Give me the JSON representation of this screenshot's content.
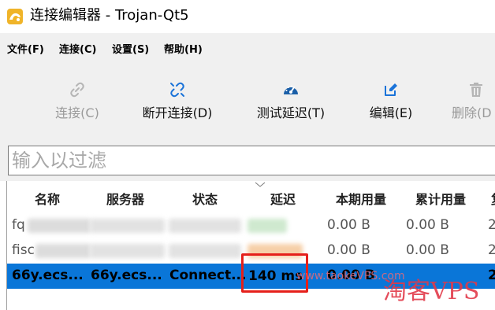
{
  "window": {
    "title": "连接编辑器 - Trojan-Qt5"
  },
  "menu": [
    {
      "label": "文件(F)"
    },
    {
      "label": "连接(C)"
    },
    {
      "label": "设置(S)"
    },
    {
      "label": "帮助(H)"
    }
  ],
  "toolbar": {
    "connect": {
      "label": "连接(C)",
      "icon": "link-icon",
      "enabled": false
    },
    "disconnect": {
      "label": "断开连接(D)",
      "icon": "broken-link-icon",
      "enabled": true
    },
    "test_latency": {
      "label": "测试延迟(T)",
      "icon": "speedometer-icon",
      "enabled": true
    },
    "edit": {
      "label": "编辑(E)",
      "icon": "pencil-icon",
      "enabled": true
    },
    "delete": {
      "label": "删除(D",
      "icon": "trash-icon",
      "enabled": false
    }
  },
  "filter": {
    "placeholder": "输入以过滤",
    "value": ""
  },
  "table": {
    "columns": [
      "名称",
      "服务器",
      "状态",
      "延迟",
      "本期用量",
      "累计用量",
      "复"
    ],
    "rows": [
      {
        "name": "fq",
        "server": "",
        "status": "",
        "latency": "",
        "period_usage": "0.00  B",
        "total_usage": "0.00  B",
        "extra": "2",
        "selected": false
      },
      {
        "name": "fisc",
        "server": "",
        "status": "",
        "latency": "",
        "period_usage": "0.00  B",
        "total_usage": "0.00  B",
        "extra": "2",
        "selected": false
      },
      {
        "name": "66y.ecs...",
        "server": "66y.ecs...",
        "status": "Connect...",
        "latency": "140 ms",
        "period_usage": "0.00  B",
        "total_usage": "",
        "extra": "20",
        "selected": true
      }
    ]
  },
  "watermark": {
    "text": "淘客VPS",
    "sub": "www.taokeVPS.com"
  },
  "colors": {
    "selection": "#0a76d8",
    "accent_icon": "#1a73d9",
    "highlight_box": "#e5201b",
    "watermark": "#e23a4a"
  }
}
